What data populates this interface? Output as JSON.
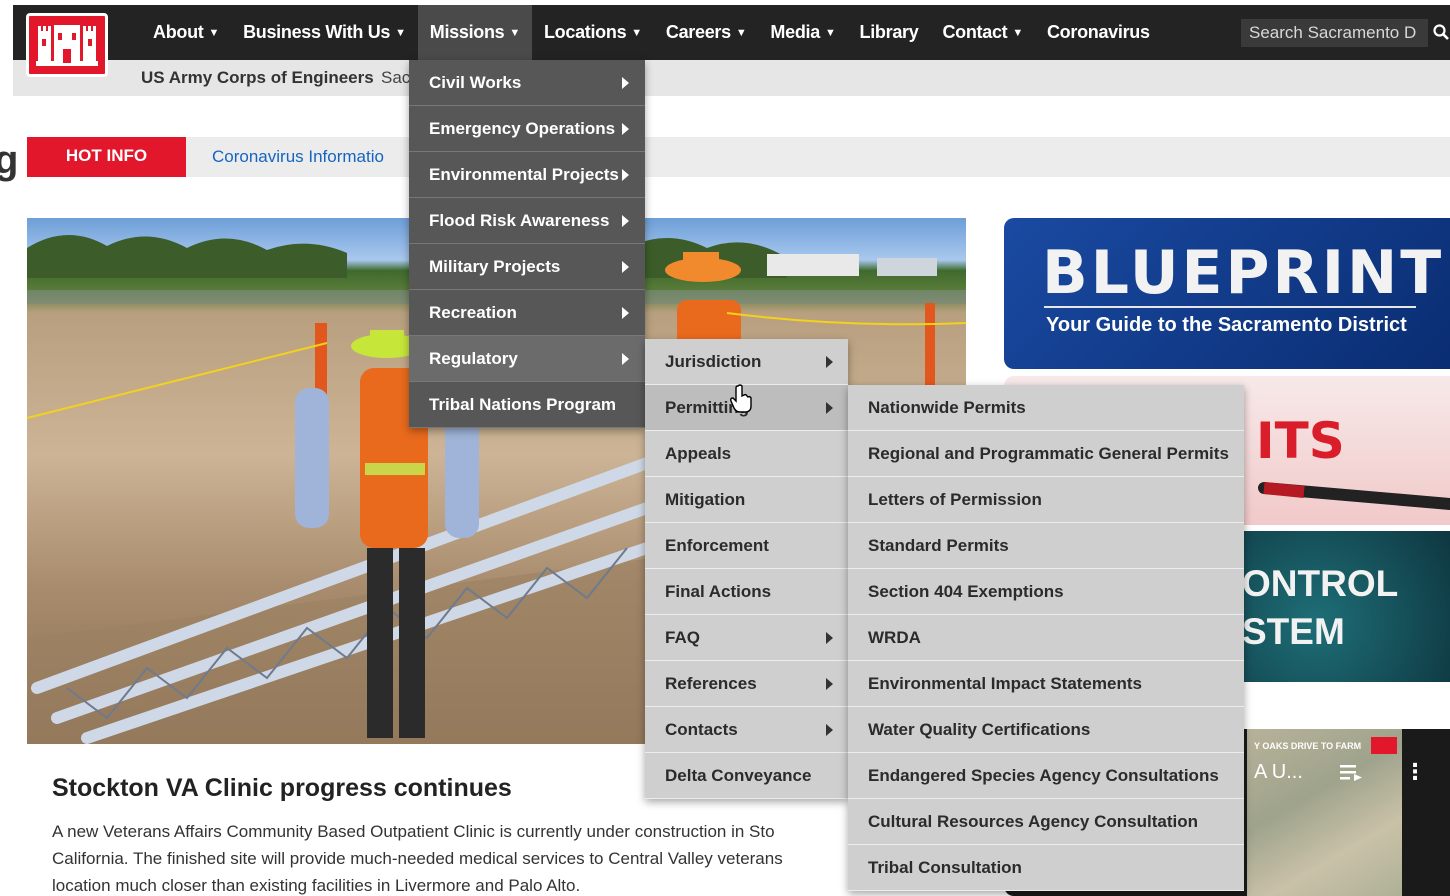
{
  "nav": {
    "items": [
      {
        "label": "About",
        "caret": true
      },
      {
        "label": "Business With Us",
        "caret": true
      },
      {
        "label": "Missions",
        "caret": true,
        "active": true
      },
      {
        "label": "Locations",
        "caret": true
      },
      {
        "label": "Careers",
        "caret": true
      },
      {
        "label": "Media",
        "caret": true
      },
      {
        "label": "Library",
        "caret": false
      },
      {
        "label": "Contact",
        "caret": true
      },
      {
        "label": "Coronavirus",
        "caret": false
      }
    ],
    "search_value": "Search Sacramento D",
    "caret_glyph": "▼"
  },
  "header": {
    "registered": "®",
    "org_name": "US Army Corps of Engineers",
    "district_partial": "Sac"
  },
  "page": {
    "cut_letter": "g"
  },
  "hotinfo": {
    "label": "HOT INFO",
    "link": "Coronavirus Informatio"
  },
  "missions_menu": {
    "items": [
      {
        "label": "Civil Works",
        "arrow": true
      },
      {
        "label": "Emergency Operations",
        "arrow": true
      },
      {
        "label": "Environmental Projects",
        "arrow": true
      },
      {
        "label": "Flood Risk Awareness",
        "arrow": true
      },
      {
        "label": "Military Projects",
        "arrow": true
      },
      {
        "label": "Recreation",
        "arrow": true
      },
      {
        "label": "Regulatory",
        "arrow": true,
        "highlighted": true
      },
      {
        "label": "Tribal Nations Program",
        "arrow": false
      }
    ]
  },
  "regulatory_menu": {
    "items": [
      {
        "label": "Jurisdiction",
        "arrow": true
      },
      {
        "label": "Permitting",
        "arrow": true,
        "highlighted": true
      },
      {
        "label": "Appeals",
        "arrow": false
      },
      {
        "label": "Mitigation",
        "arrow": false
      },
      {
        "label": "Enforcement",
        "arrow": false
      },
      {
        "label": "Final Actions",
        "arrow": false
      },
      {
        "label": "FAQ",
        "arrow": true
      },
      {
        "label": "References",
        "arrow": true
      },
      {
        "label": "Contacts",
        "arrow": true
      },
      {
        "label": "Delta Conveyance",
        "arrow": false
      }
    ]
  },
  "permitting_menu": {
    "items": [
      "Nationwide Permits",
      "Regional and Programmatic General Permits",
      "Letters of Permission",
      "Standard Permits",
      "Section 404 Exemptions",
      "WRDA",
      "Environmental Impact Statements",
      "Water Quality Certifications",
      "Endangered Species Agency Consultations",
      "Cultural Resources Agency Consultation",
      "Tribal Consultation"
    ]
  },
  "promos": {
    "blueprint_title": "BLUEPRINT",
    "blueprint_sub": "Your Guide to the Sacramento District",
    "permits_text": "ITS",
    "water_line1": "ONTROL",
    "water_line2": "STEM",
    "video_caption": "Y OAKS DRIVE TO FARM",
    "video_title": "A U...",
    "video_more": "⋮"
  },
  "news": {
    "title": "Stockton VA Clinic progress continues",
    "lines": [
      "A new Veterans Affairs Community Based Outpatient Clinic is currently under construction in Sto",
      "California. The finished site will provide much-needed medical services to Central Valley veterans",
      "location much closer than existing facilities in Livermore and Palo Alto."
    ]
  },
  "colors": {
    "nav_bg": "#232323",
    "brand_red": "#e3172b",
    "menu_dark": "#575757",
    "menu_light": "#cfcfcf",
    "link_blue": "#1565c0"
  }
}
